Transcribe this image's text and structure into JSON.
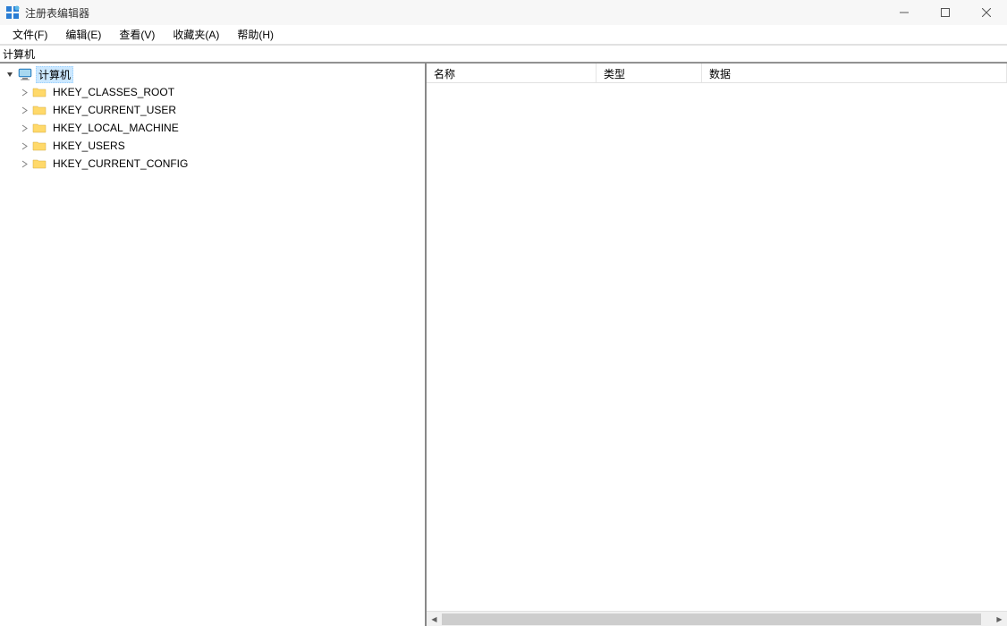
{
  "window": {
    "title": "注册表编辑器"
  },
  "menus": {
    "file": "文件(F)",
    "edit": "编辑(E)",
    "view": "查看(V)",
    "favorites": "收藏夹(A)",
    "help": "帮助(H)"
  },
  "address": "计算机",
  "tree": {
    "root": {
      "label": "计算机",
      "expanded": true,
      "selected": true
    },
    "children": [
      {
        "label": "HKEY_CLASSES_ROOT"
      },
      {
        "label": "HKEY_CURRENT_USER"
      },
      {
        "label": "HKEY_LOCAL_MACHINE"
      },
      {
        "label": "HKEY_USERS"
      },
      {
        "label": "HKEY_CURRENT_CONFIG"
      }
    ]
  },
  "list": {
    "columns": {
      "name": "名称",
      "type": "类型",
      "data": "数据"
    }
  }
}
